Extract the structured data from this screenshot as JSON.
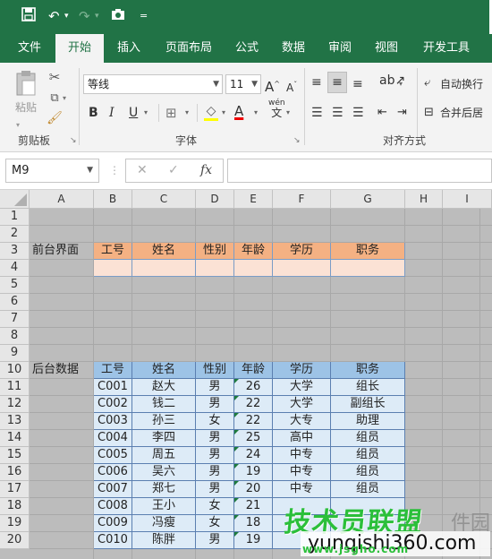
{
  "qat": {
    "icons": [
      "save-icon",
      "undo-icon",
      "redo-icon",
      "camera-icon",
      "customize-icon"
    ]
  },
  "tabs": [
    "文件",
    "开始",
    "插入",
    "页面布局",
    "公式",
    "数据",
    "审阅",
    "视图",
    "开发工具"
  ],
  "active_tab": "开始",
  "ribbon": {
    "clipboard": {
      "paste_label": "粘贴",
      "group_label": "剪贴板"
    },
    "font": {
      "font_name": "等线",
      "font_size": "11",
      "bold": "B",
      "italic": "I",
      "underline": "U",
      "grow": "A",
      "shrink": "A",
      "font_color": "A",
      "wen": "wén",
      "zi": "文",
      "group_label": "字体"
    },
    "alignment": {
      "wrap_text": "自动换行",
      "merge_center": "合并后居",
      "group_label": "对齐方式"
    }
  },
  "formula_bar": {
    "name_box": "M9",
    "fx": "fx"
  },
  "sheet": {
    "columns": [
      "A",
      "B",
      "C",
      "D",
      "E",
      "F",
      "G",
      "H",
      "I"
    ],
    "rows": [
      "1",
      "2",
      "3",
      "4",
      "5",
      "6",
      "7",
      "8",
      "9",
      "10",
      "11",
      "12",
      "13",
      "14",
      "15",
      "16",
      "17",
      "18",
      "19",
      "20"
    ],
    "front_label": "前台界面",
    "back_label": "后台数据",
    "headers": [
      "工号",
      "姓名",
      "性别",
      "年龄",
      "学历",
      "职务"
    ],
    "records": [
      [
        "C001",
        "赵大",
        "男",
        "26",
        "大学",
        "组长"
      ],
      [
        "C002",
        "钱二",
        "男",
        "22",
        "大学",
        "副组长"
      ],
      [
        "C003",
        "孙三",
        "女",
        "22",
        "大专",
        "助理"
      ],
      [
        "C004",
        "李四",
        "男",
        "25",
        "高中",
        "组员"
      ],
      [
        "C005",
        "周五",
        "男",
        "24",
        "中专",
        "组员"
      ],
      [
        "C006",
        "吴六",
        "男",
        "19",
        "中专",
        "组员"
      ],
      [
        "C007",
        "郑七",
        "男",
        "20",
        "中专",
        "组员"
      ],
      [
        "C008",
        "王小",
        "女",
        "21",
        "",
        ""
      ],
      [
        "C009",
        "冯瘦",
        "女",
        "18",
        "",
        ""
      ],
      [
        "C010",
        "陈胖",
        "男",
        "19",
        "",
        ""
      ]
    ]
  },
  "watermark": {
    "main": "技术员联盟",
    "url": "yunqishi360.com",
    "sub": "www.jsgho.com",
    "grey": "件园"
  },
  "colors": {
    "excel_green": "#217346",
    "orange_header": "#f4b183",
    "orange_light": "#fbe2d5",
    "blue_header": "#9dc3e6",
    "blue_light": "#ddebf7"
  }
}
